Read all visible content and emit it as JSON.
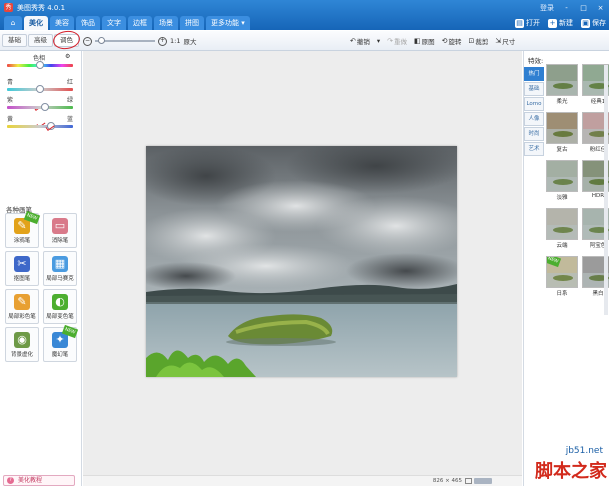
{
  "app": {
    "title": "美图秀秀 4.0.1",
    "logo_char": "秀"
  },
  "window": {
    "login": "登录",
    "buttons": [
      "-",
      "□",
      "×"
    ]
  },
  "tabs": [
    {
      "label": "⌂",
      "name": "home"
    },
    {
      "label": "美化",
      "name": "beautify",
      "active": true
    },
    {
      "label": "美容",
      "name": "beauty"
    },
    {
      "label": "饰品",
      "name": "accessories"
    },
    {
      "label": "文字",
      "name": "text"
    },
    {
      "label": "边框",
      "name": "frame"
    },
    {
      "label": "场景",
      "name": "scene"
    },
    {
      "label": "拼图",
      "name": "collage"
    },
    {
      "label": "更多功能 ▾",
      "name": "more"
    }
  ],
  "top_actions": [
    {
      "label": "打开",
      "icon": "open-icon",
      "glyph": "▤"
    },
    {
      "label": "新建",
      "icon": "new-icon",
      "glyph": "+"
    },
    {
      "label": "保存",
      "icon": "save-icon",
      "glyph": "▣"
    }
  ],
  "subtabs": [
    {
      "label": "基础"
    },
    {
      "label": "高级"
    },
    {
      "label": "调色",
      "active": true
    }
  ],
  "zoom": {
    "minus": "−",
    "plus": "+",
    "ratio": "1:1",
    "fit": "原大",
    "level": 0.05
  },
  "tools": [
    {
      "label": "撤销",
      "glyph": "↶",
      "name": "undo"
    },
    {
      "label": "▾",
      "glyph": "",
      "name": "undo-menu"
    },
    {
      "label": "重做",
      "glyph": "↷",
      "name": "redo",
      "disabled": true
    },
    {
      "label": "原图",
      "glyph": "◧",
      "name": "original"
    },
    {
      "label": "旋转",
      "glyph": "⟲",
      "name": "rotate"
    },
    {
      "label": "裁剪",
      "glyph": "⊡",
      "name": "crop"
    },
    {
      "label": "尺寸",
      "glyph": "⇲",
      "name": "resize"
    }
  ],
  "color_adjust": {
    "hue": {
      "label": "色相",
      "value": 0.5
    },
    "cyan_red": {
      "left": "青",
      "right": "红",
      "value": 0.5
    },
    "magenta_green": {
      "left": "紫",
      "right": "绿",
      "value": 0.57
    },
    "yellow_blue": {
      "left": "黄",
      "right": "蓝",
      "value": 0.66
    }
  },
  "brushes": {
    "title": "各种画笔",
    "items": [
      {
        "label": "涂鸦笔",
        "glyph": "✎",
        "color": "#e2a21a",
        "new": true
      },
      {
        "label": "消除笔",
        "glyph": "▭",
        "color": "#d97a8a"
      },
      {
        "label": "抠图笔",
        "glyph": "✂",
        "color": "#3e68c9"
      },
      {
        "label": "局部马赛克",
        "glyph": "▦",
        "color": "#4a9be0"
      },
      {
        "label": "局部彩色笔",
        "glyph": "✎",
        "color": "#e8a032"
      },
      {
        "label": "局部变色笔",
        "glyph": "◐",
        "color": "#4cae2f"
      },
      {
        "label": "背景虚化",
        "glyph": "◉",
        "color": "#6e9a47"
      },
      {
        "label": "魔幻笔",
        "glyph": "✦",
        "color": "#3a88d6",
        "new": true
      }
    ],
    "new_badge": "NEW"
  },
  "tutorial": {
    "label": "美化教程",
    "glyph": "?"
  },
  "status": {
    "dims": "826 × 465"
  },
  "effects": {
    "title": "特效:",
    "categories": [
      {
        "label": "热门",
        "active": true
      },
      {
        "label": "基础"
      },
      {
        "label": "Lomo"
      },
      {
        "label": "人像"
      },
      {
        "label": "时尚"
      },
      {
        "label": "艺术"
      }
    ],
    "items": [
      {
        "label": "柔光",
        "tint": "#7b8f78"
      },
      {
        "label": "经典1",
        "tint": "#7d9a7e"
      },
      {
        "label": "复古",
        "tint": "#8d7a5c"
      },
      {
        "label": "粉红佳",
        "tint": "#b58f8f"
      },
      {
        "label": "淡雅",
        "tint": "#93a192"
      },
      {
        "label": "HDR",
        "tint": "#6f7f63"
      },
      {
        "label": "云端",
        "tint": "#a8a89d"
      },
      {
        "label": "阿宝色",
        "tint": "#98a6a0"
      },
      {
        "label": "日系",
        "tint": "#b7ae8a",
        "new": true
      },
      {
        "label": "黑白",
        "tint": "#8a8a8a"
      }
    ]
  },
  "watermark": {
    "site": "jb51.net",
    "text": "脚本之家"
  }
}
